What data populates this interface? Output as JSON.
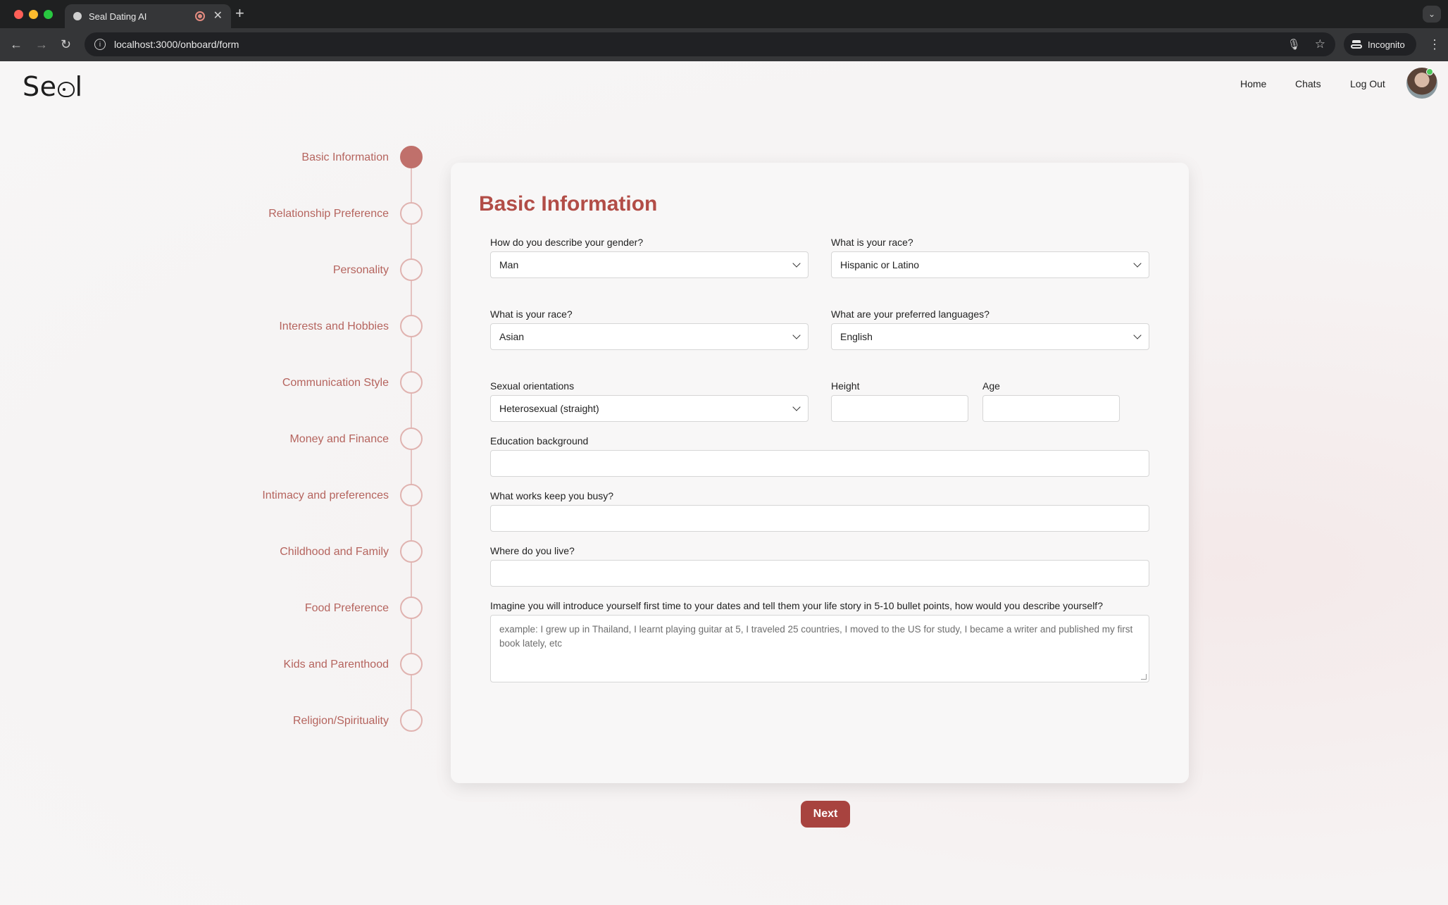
{
  "browser": {
    "tab_title": "Seal Dating AI",
    "url": "localhost:3000/onboard/form",
    "incognito_label": "Incognito"
  },
  "header": {
    "logo": {
      "prefix": "Se",
      "suffix": "l"
    },
    "nav": [
      "Home",
      "Chats",
      "Log Out"
    ]
  },
  "stepper": {
    "active_index": 0,
    "steps": [
      "Basic Information",
      "Relationship Preference",
      "Personality",
      "Interests and Hobbies",
      "Communication Style",
      "Money and Finance",
      "Intimacy and preferences",
      "Childhood and Family",
      "Food Preference",
      "Kids and Parenthood",
      "Religion/Spirituality"
    ]
  },
  "form": {
    "title": "Basic Information",
    "gender": {
      "label": "How do you describe your gender?",
      "value": "Man"
    },
    "race1": {
      "label": "What is your race?",
      "value": "Hispanic or Latino"
    },
    "race2": {
      "label": "What is your race?",
      "value": "Asian"
    },
    "languages": {
      "label": "What are your preferred languages?",
      "value": "English"
    },
    "orientation": {
      "label": "Sexual orientations",
      "value": "Heterosexual (straight)"
    },
    "height": {
      "label": "Height",
      "value": ""
    },
    "age": {
      "label": "Age",
      "value": ""
    },
    "education": {
      "label": "Education background",
      "value": ""
    },
    "work": {
      "label": "What works keep you busy?",
      "value": ""
    },
    "location": {
      "label": "Where do you live?",
      "value": ""
    },
    "story": {
      "label": "Imagine you will introduce yourself first time to your dates and tell them your life story in 5-10 bullet points, how would you describe yourself?",
      "placeholder": "example: I grew up in Thailand, I learnt playing guitar at 5, I traveled 25 countries, I moved to the US for study, I became a writer and published my first book lately, etc"
    },
    "next_label": "Next"
  },
  "colors": {
    "accent": "#b24d47",
    "step_active": "#c0706b",
    "step_border": "#e0b3b0",
    "button": "#a8433f"
  }
}
